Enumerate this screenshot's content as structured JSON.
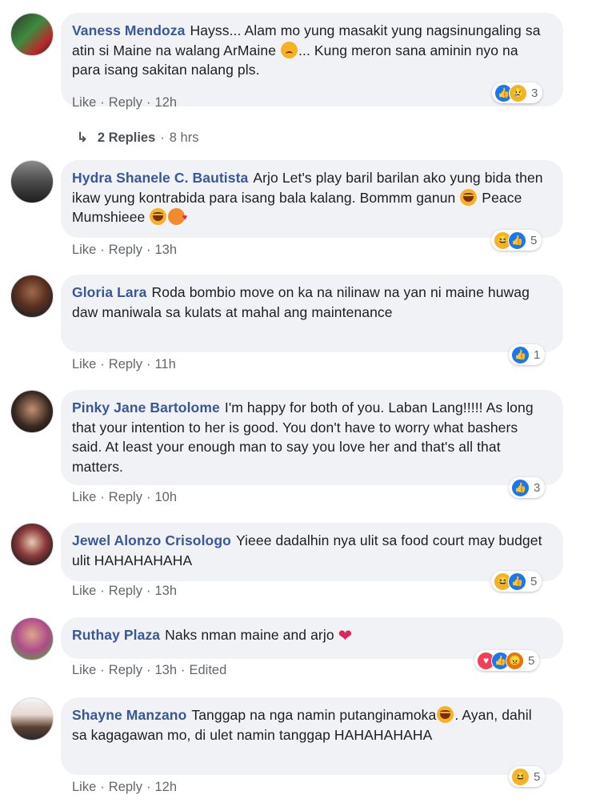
{
  "actions": {
    "like": "Like",
    "reply": "Reply",
    "dot": "·"
  },
  "replies": {
    "label": "2 Replies",
    "time": "8 hrs"
  },
  "comments": [
    {
      "author": "Vaness Mendoza",
      "text_a": "Hayss... Alam mo yung masakit yung nagsinungaling sa atin si Maine na walang ArMaine",
      "text_b": "... Kung meron sana aminin nyo na para isang sakitan nalang pls.",
      "time": "12h",
      "reactions": [
        "like",
        "sad"
      ],
      "count": "3"
    },
    {
      "author": "Hydra Shanele C. Bautista",
      "text_a": "Arjo Let's play baril barilan ako yung bida then ikaw yung kontrabida para isang bala kalang. Bommm ganun",
      "text_b": "Peace Mumshieee",
      "time": "13h",
      "reactions": [
        "haha",
        "like"
      ],
      "count": "5"
    },
    {
      "author": "Gloria Lara",
      "text_a": "Roda bombio move on ka na nilinaw na yan ni maine huwag daw maniwala sa kulats at mahal ang maintenance",
      "time": "11h",
      "reactions": [
        "like"
      ],
      "count": "1"
    },
    {
      "author": "Pinky Jane Bartolome",
      "text_a": "I'm happy for both of you. Laban Lang!!!!! As long that your intention to her is good. You don't have to worry what bashers said. At least your enough man to say you love her and that's all that matters.",
      "time": "10h",
      "reactions": [
        "like"
      ],
      "count": "3"
    },
    {
      "author": "Jewel Alonzo Crisologo",
      "text_a": "Yieee dadalhin nya ulit sa food court may budget ulit HAHAHAHAHA",
      "time": "13h",
      "reactions": [
        "haha",
        "like"
      ],
      "count": "5"
    },
    {
      "author": "Ruthay Plaza",
      "text_a": "Naks nman maine and arjo",
      "time": "13h",
      "edited": "Edited",
      "reactions": [
        "love",
        "like",
        "angry"
      ],
      "count": "5"
    },
    {
      "author": "Shayne Manzano",
      "text_a": "Tanggap na nga namin putanginamoka",
      "text_b": ". Ayan, dahil sa kagagawan mo, di ulet namin tanggap HAHAHAHAHA",
      "time": "12h",
      "reactions": [
        "haha"
      ],
      "count": "5"
    }
  ],
  "colors": {
    "author": "#385898",
    "bubble": "#f0f2f5",
    "meta": "#65676b",
    "like": "#1877f2",
    "haha": "#f7b125",
    "love": "#f33e58"
  }
}
